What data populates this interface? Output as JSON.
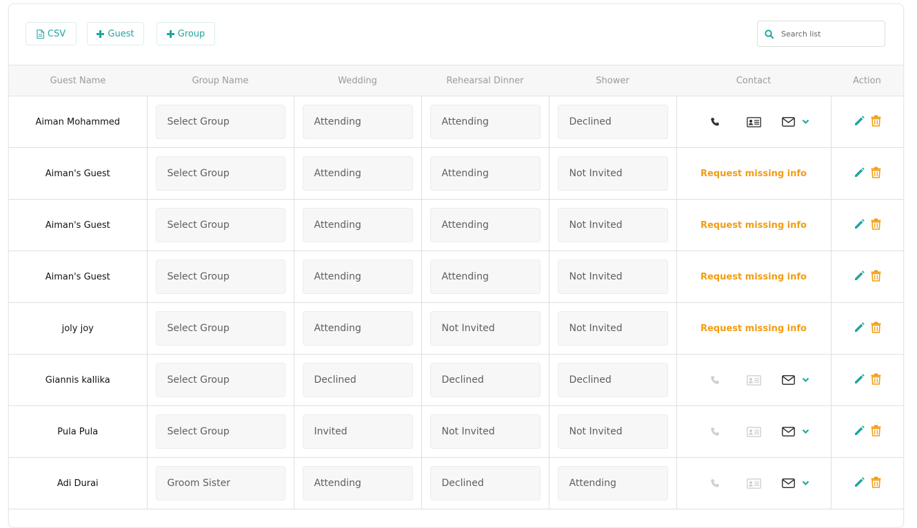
{
  "toolbar": {
    "csv_label": "CSV",
    "guest_label": "Guest",
    "group_label": "Group"
  },
  "search": {
    "placeholder": "Search list"
  },
  "columns": [
    "Guest Name",
    "Group Name",
    "Wedding",
    "Rehearsal Dinner",
    "Shower",
    "Contact",
    "Action"
  ],
  "colors": {
    "accent": "#1fa59e",
    "warning": "#f39c12",
    "muted_icon": "#cfcfcf",
    "dark_icon": "#333333"
  },
  "rows": [
    {
      "name": "Aiman Mohammed",
      "group": "Select Group",
      "wedding": "Attending",
      "rehearsal": "Attending",
      "shower": "Declined",
      "contact": "icons",
      "contact_enabled": true
    },
    {
      "name": "Aiman's Guest",
      "group": "Select Group",
      "wedding": "Attending",
      "rehearsal": "Attending",
      "shower": "Not Invited",
      "contact": "Request missing info"
    },
    {
      "name": "Aiman's Guest",
      "group": "Select Group",
      "wedding": "Attending",
      "rehearsal": "Attending",
      "shower": "Not Invited",
      "contact": "Request missing info"
    },
    {
      "name": "Aiman's Guest",
      "group": "Select Group",
      "wedding": "Attending",
      "rehearsal": "Attending",
      "shower": "Not Invited",
      "contact": "Request missing info"
    },
    {
      "name": "joly joy",
      "group": "Select Group",
      "wedding": "Attending",
      "rehearsal": "Not Invited",
      "shower": "Not Invited",
      "contact": "Request missing info"
    },
    {
      "name": "Giannis kallika",
      "group": "Select Group",
      "wedding": "Declined",
      "rehearsal": "Declined",
      "shower": "Declined",
      "contact": "icons",
      "contact_enabled": false
    },
    {
      "name": "Pula Pula",
      "group": "Select Group",
      "wedding": "Invited",
      "rehearsal": "Not Invited",
      "shower": "Not Invited",
      "contact": "icons",
      "contact_enabled": false
    },
    {
      "name": "Adi Durai",
      "group": "Groom Sister",
      "wedding": "Attending",
      "rehearsal": "Declined",
      "shower": "Attending",
      "contact": "icons",
      "contact_enabled": false
    }
  ]
}
